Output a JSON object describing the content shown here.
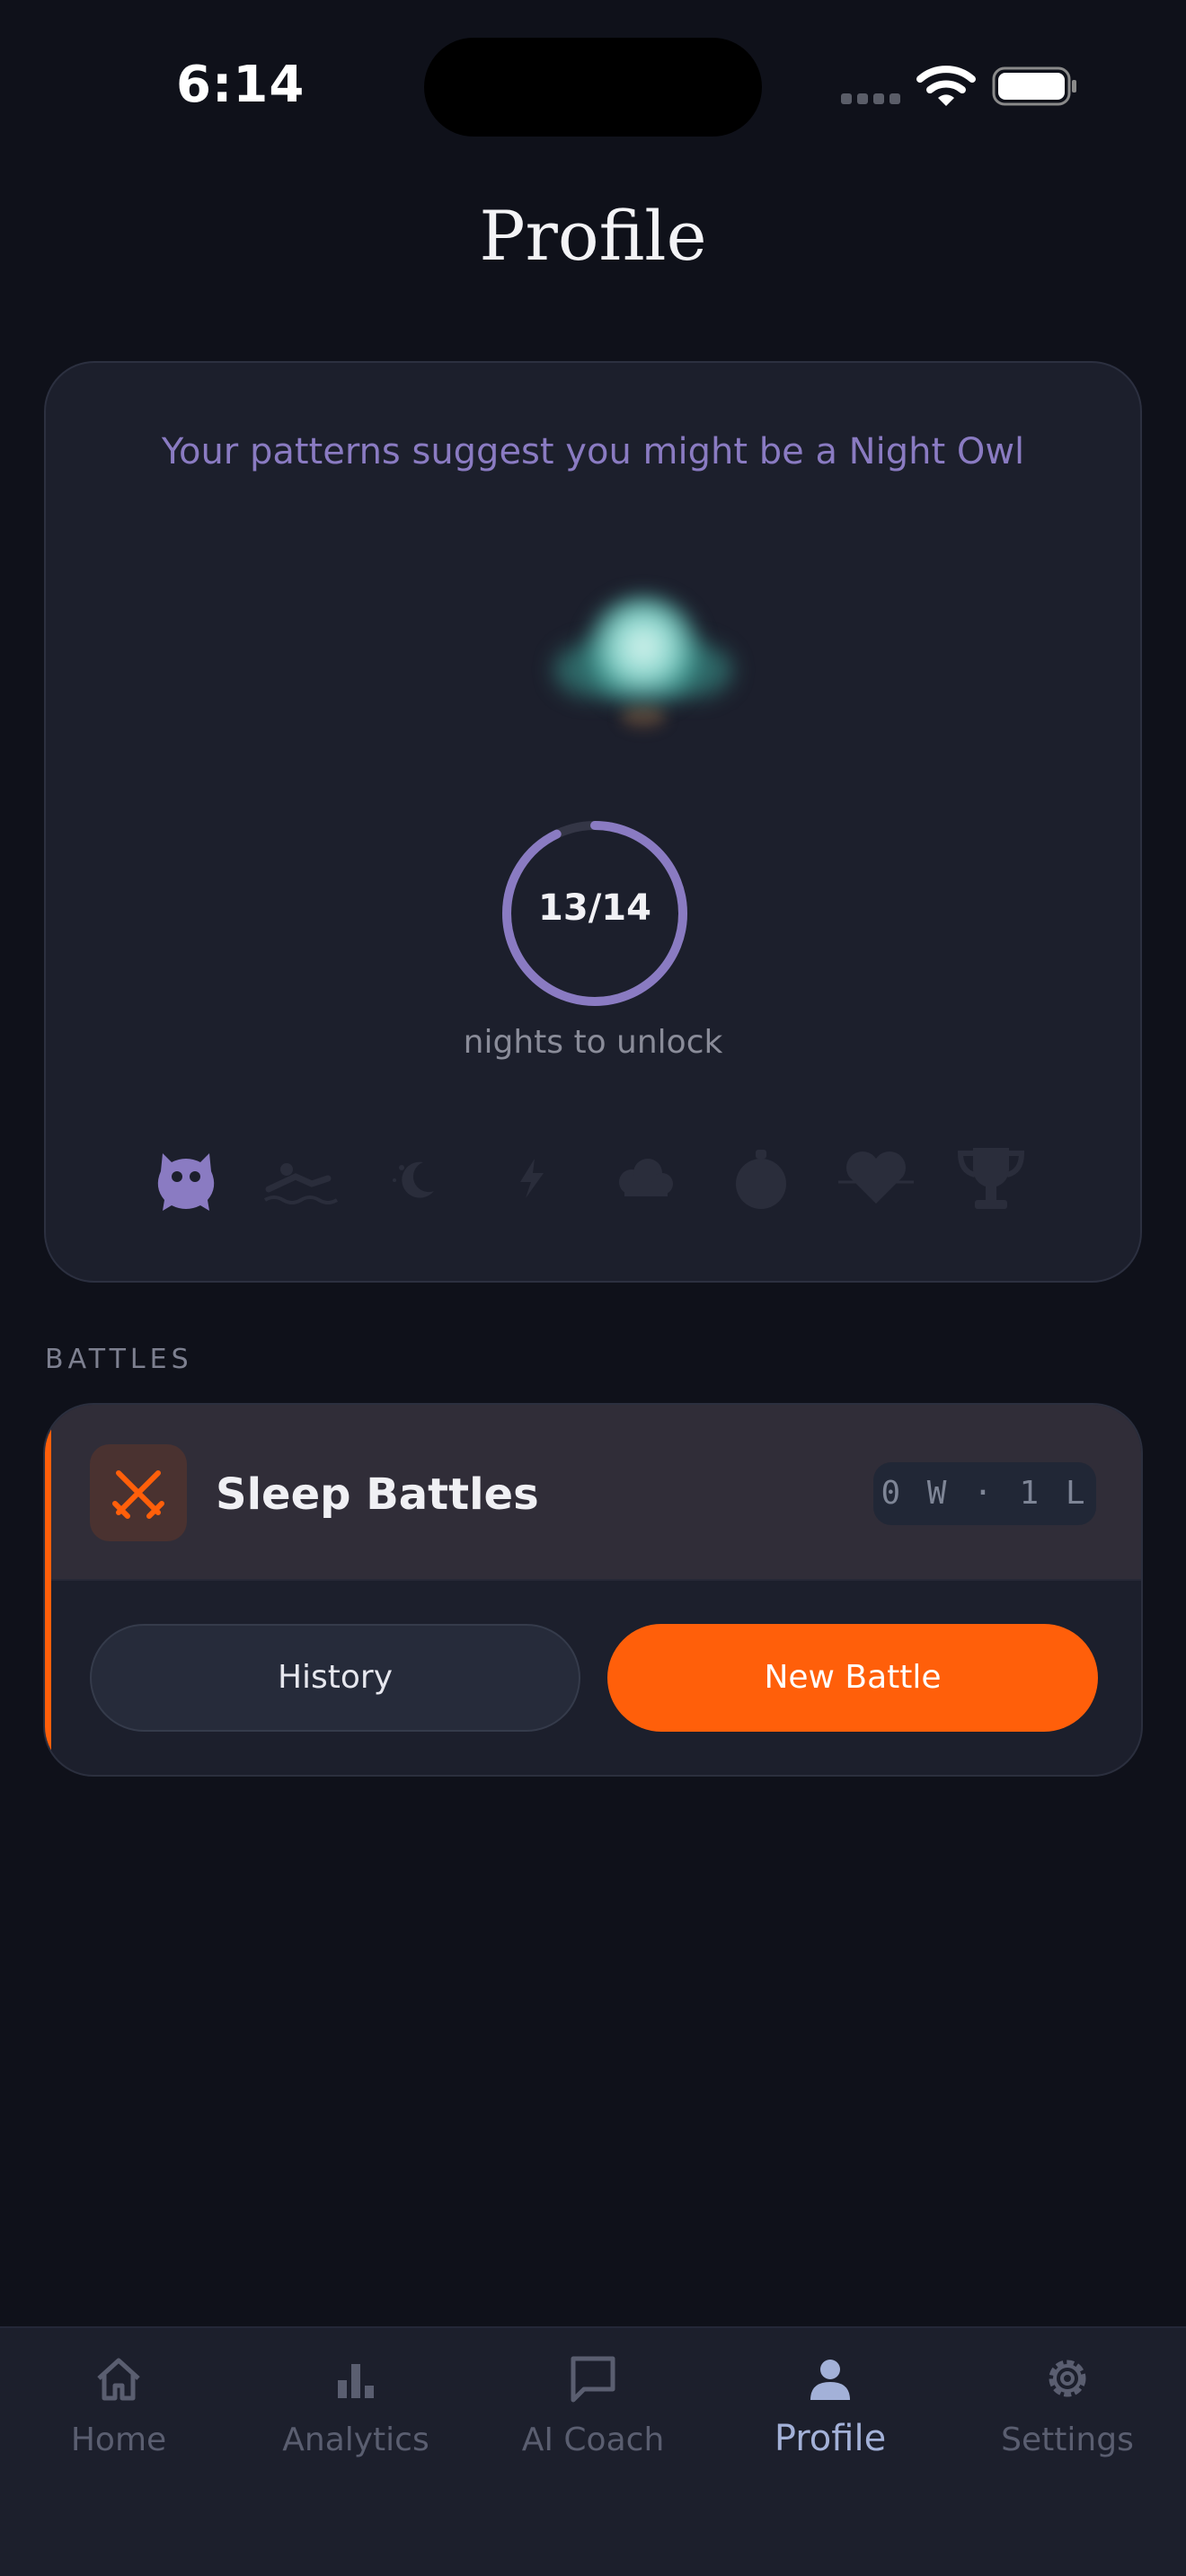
{
  "status_bar": {
    "time": "6:14"
  },
  "header": {
    "title": "Profile"
  },
  "profile_card": {
    "suggestion": "Your patterns suggest you might be a Night Owl",
    "progress": {
      "current": 13,
      "total": 14,
      "display": "13/14",
      "caption": "nights to unlock"
    },
    "badges": [
      {
        "icon": "owl-icon",
        "state": "active"
      },
      {
        "icon": "swimmer-icon",
        "state": "locked"
      },
      {
        "icon": "moon-icon",
        "state": "locked"
      },
      {
        "icon": "lightning-icon",
        "state": "locked"
      },
      {
        "icon": "cloud-icon",
        "state": "locked"
      },
      {
        "icon": "stopwatch-icon",
        "state": "locked"
      },
      {
        "icon": "heart-icon",
        "state": "locked"
      },
      {
        "icon": "trophy-icon",
        "state": "locked"
      }
    ]
  },
  "battles": {
    "section_label": "BATTLES",
    "title": "Sleep Battles",
    "record": "0 W · 1 L",
    "history_label": "History",
    "new_battle_label": "New Battle"
  },
  "tab_bar": {
    "items": [
      {
        "label": "Home",
        "icon": "home-icon",
        "active": false
      },
      {
        "label": "Analytics",
        "icon": "bar-chart-icon",
        "active": false
      },
      {
        "label": "AI Coach",
        "icon": "chat-bubble-icon",
        "active": false
      },
      {
        "label": "Profile",
        "icon": "person-icon",
        "active": true
      },
      {
        "label": "Settings",
        "icon": "gear-icon",
        "active": false
      }
    ]
  },
  "colors": {
    "background": "#0f111a",
    "card": "#1c1f2c",
    "accent_purple": "#8a7bc2",
    "accent_orange": "#ff5f0a",
    "active_tab": "#a3b1d8"
  }
}
